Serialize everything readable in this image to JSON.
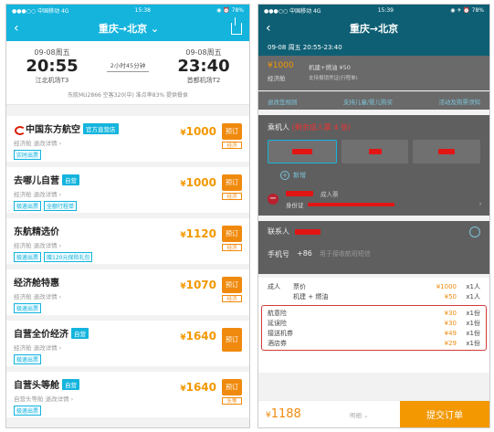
{
  "left": {
    "status": {
      "carrier": "●●●○○ 中国移动 4G",
      "time": "15:38",
      "battery": "◉ ⏰ 78%"
    },
    "nav": {
      "back": "‹",
      "title": "重庆→北京 ⌄"
    },
    "summary": {
      "dep_date": "09-08周五",
      "dep_time": "20:55",
      "dep_airport": "江北机场T3",
      "duration": "2小时45分钟",
      "arr_date": "09-08周五",
      "arr_time": "23:40",
      "arr_airport": "首都机场T2",
      "flight_info": "东航MU2866  空客320(中)  准点率83%  提供餐食"
    },
    "offers": [
      {
        "name": "中国东方航空",
        "tag": "官方直营店",
        "sub": "经济舱  退改详情 ›",
        "tags": [
          "实时出票"
        ],
        "price": "1000",
        "book": "预订",
        "book_sub": "经济"
      },
      {
        "name": "去哪儿自营",
        "tag": "自营",
        "sub": "经济舱  退改详情 ›",
        "tags": [
          "极速出票",
          "全额行程单"
        ],
        "price": "1000",
        "book": "预订",
        "book_sub": "经济"
      },
      {
        "name": "东航精选价",
        "tag": "",
        "sub": "经济舱  退改详情 ›",
        "tags": [
          "极速出票",
          "赠120元保险礼包"
        ],
        "price": "1120",
        "book": "预订",
        "book_sub": "经济"
      },
      {
        "name": "经济舱特惠",
        "tag": "",
        "sub": "经济舱  退改详情 ›",
        "tags": [
          "极速出票"
        ],
        "price": "1070",
        "book": "预订",
        "book_sub": "经济"
      },
      {
        "name": "自营全价经济",
        "tag": "自营",
        "sub": "经济舱  退改详情 ›",
        "tags": [
          "极速出票"
        ],
        "price": "1640",
        "book": "预订",
        "book_sub": ""
      },
      {
        "name": "自营头等舱",
        "tag": "自营",
        "sub": "自营头等舱  退改详情 ›",
        "tags": [
          "极速出票"
        ],
        "price": "1640",
        "book": "预订",
        "book_sub": "头等"
      }
    ]
  },
  "right": {
    "status": {
      "carrier": "●●●○○ 中国移动 4G",
      "time": "15:39",
      "battery": "◉ ✈ ⏰ 78%"
    },
    "nav": {
      "back": "‹",
      "title": "重庆→北京"
    },
    "head": "09-08 周五 20:55-23:40",
    "fare": {
      "price": "¥1000",
      "fee": "机建+燃油 ¥50",
      "cls": "经济舱",
      "notice": "支持报销凭证(行程单)"
    },
    "links": [
      "退改签规则",
      "支持儿童/婴儿购买",
      "活动及购票须知"
    ],
    "passenger": {
      "label": "乘机人",
      "remain": "(剩余成人票 4 张)",
      "add": "新增",
      "type": "成人票",
      "id_label": "身份证"
    },
    "contact": {
      "label": "联系人",
      "phone_label": "手机号",
      "code": "+86",
      "placeholder": "用于接收航班短信"
    },
    "details": [
      {
        "a": "成人",
        "b": "票价",
        "c": "¥1000",
        "d": "x1人"
      },
      {
        "a": "",
        "b": "机建 + 燃油",
        "c": "¥50",
        "d": "x1人"
      }
    ],
    "insurance": [
      {
        "a": "航意险",
        "c": "¥30",
        "d": "x1份"
      },
      {
        "a": "延误险",
        "c": "¥30",
        "d": "x1份"
      },
      {
        "a": "接送机券",
        "c": "¥49",
        "d": "x1份"
      },
      {
        "a": "酒店券",
        "c": "¥29",
        "d": "x1份"
      }
    ],
    "bottom": {
      "total": "1188",
      "detail": "明细 ⌄",
      "submit": "提交订单"
    }
  },
  "colors": {
    "accent": "#14b4dd",
    "price": "#f39800",
    "dark_teal": "#0f5f74"
  }
}
